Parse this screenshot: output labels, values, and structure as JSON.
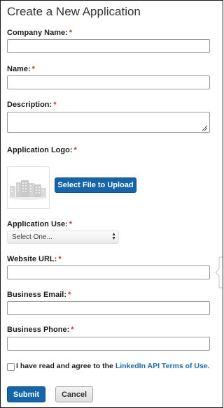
{
  "page": {
    "title": "Create a New Application"
  },
  "form": {
    "required_marker": "*",
    "company_name": {
      "label": "Company Name:",
      "value": ""
    },
    "name": {
      "label": "Name:",
      "value": ""
    },
    "description": {
      "label": "Description:",
      "value": ""
    },
    "application_logo": {
      "label": "Application Logo:",
      "upload_button": "Select File to Upload",
      "placeholder_icon": "city-buildings-icon"
    },
    "application_use": {
      "label": "Application Use:",
      "selected": "Select One..."
    },
    "website_url": {
      "label": "Website URL:",
      "value": ""
    },
    "business_email": {
      "label": "Business Email:",
      "value": ""
    },
    "business_phone": {
      "label": "Business Phone:",
      "value": ""
    },
    "agreement": {
      "text": "I have read and agree to the",
      "link_text": "LinkedIn API Terms of Use.",
      "checked": false
    },
    "submit_label": "Submit",
    "cancel_label": "Cancel"
  },
  "colors": {
    "primary_button": "#1565a8",
    "required_asterisk": "#c0392b",
    "link": "#1d6fa5"
  }
}
